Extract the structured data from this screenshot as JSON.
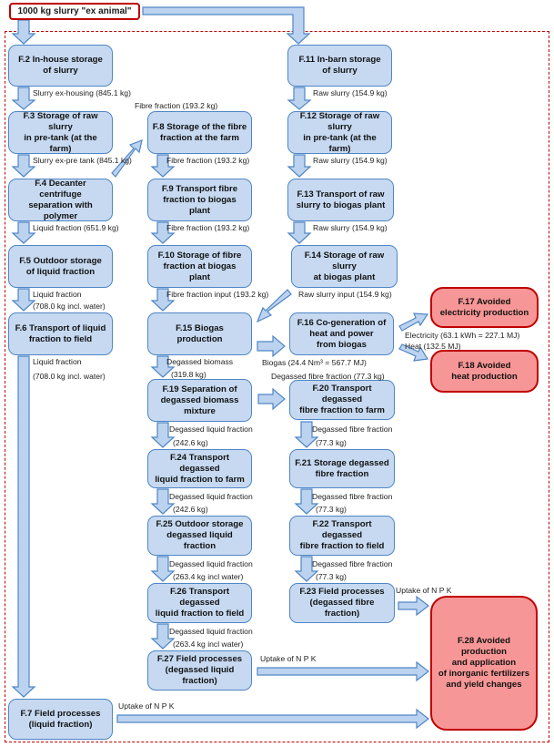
{
  "start": {
    "label": "1000 kg slurry \"ex animal\""
  },
  "nodes": {
    "f2": "F.2 In-house storage\nof slurry",
    "f3": "F.3 Storage of raw slurry\nin pre-tank (at the farm)",
    "f4": "F.4 Decanter centrifuge\nseparation with polymer",
    "f5": "F.5 Outdoor storage\nof liquid fraction",
    "f6": "F.6 Transport of liquid\nfraction to field",
    "f7": "F.7 Field processes\n(liquid fraction)",
    "f8": "F.8 Storage of the fibre\nfraction at the farm",
    "f9": "F.9 Transport fibre\nfraction to biogas plant",
    "f10": "F.10 Storage of fibre\nfraction at biogas plant",
    "f11": "F.11 In-barn storage\nof slurry",
    "f12": "F.12 Storage of raw slurry\nin pre-tank (at the farm)",
    "f13": "F.13 Transport of raw\nslurry to biogas plant",
    "f14": "F.14 Storage of raw slurry\nat biogas plant",
    "f15": "F.15 Biogas production",
    "f16": "F.16 Co-generation of\nheat and power\nfrom biogas",
    "f17": "F.17 Avoided\nelectricity production",
    "f18": "F.18 Avoided\nheat production",
    "f19": "F.19 Separation of\ndegassed biomass\nmixture",
    "f20": "F.20 Transport degassed\nfibre fraction to farm",
    "f21": "F.21 Storage degassed\nfibre fraction",
    "f22": "F.22 Transport degassed\nfibre fraction to field",
    "f23": "F.23 Field processes\n(degassed fibre fraction)",
    "f24": "F.24 Transport degassed\nliquid fraction to farm",
    "f25": "F.25 Outdoor storage\ndegassed liquid fraction",
    "f26": "F.26 Transport degassed\nliquid fraction to field",
    "f27": "F.27 Field processes\n(degassed liquid fraction)",
    "f28": "F.28 Avoided\nproduction\nand application\nof inorganic fertilizers\nand yield changes"
  },
  "flows": {
    "f2_f3": "Slurry ex-housing (845.1 kg)",
    "f3_f4": "Slurry ex-pre tank (845.1 kg)",
    "f4_f8": "Fibre fraction (193.2 kg)",
    "f4_f5": "Liquid fraction (651.9 kg)",
    "f5_f6_a": "Liquid fraction",
    "f5_f6_b": "(708.0 kg incl. water)",
    "f6_f7_a": "Liquid fraction",
    "f6_f7_b": "(708.0 kg incl. water)",
    "f7_f28": "Uptake of N  P K",
    "f8_f9": "Fibre fraction (193.2 kg)",
    "f9_f10": "Fibre fraction (193.2 kg)",
    "f10_f15": "Fibre fraction input (193.2 kg)",
    "f11_f12": "Raw slurry (154.9 kg)",
    "f12_f13": "Raw slurry (154.9 kg)",
    "f13_f14": "Raw slurry (154.9 kg)",
    "f14_f15": "Raw slurry input (154.9 kg)",
    "f15_f16": "Biogas (24.4 Nm³ = 567.7 MJ)",
    "f15_f19_a": "Degassed biomass",
    "f15_f19_b": "(319.8 kg)",
    "f16_f17": "Electricity (63.1 kWh = 227.1 MJ)",
    "f16_f18": "Heat (132.5 MJ)",
    "f19_f20": "Degassed fibre fraction (77.3 kg)",
    "f19_f24_a": "Degassed liquid fraction",
    "f19_f24_b": "(242.6 kg)",
    "f20_f21_a": "Degassed fibre fraction",
    "f20_f21_b": "(77.3 kg)",
    "f21_f22_a": "Degassed fibre fraction",
    "f21_f22_b": "(77.3 kg)",
    "f22_f23_a": "Degassed fibre fraction",
    "f22_f23_b": "(77.3 kg)",
    "f23_f28": "Uptake of N P K",
    "f24_f25_a": "Degassed liquid fraction",
    "f24_f25_b": "(242.6 kg)",
    "f25_f26_a": "Degassed liquid fraction",
    "f25_f26_b": "(263.4 kg incl water)",
    "f26_f27_a": "Degassed liquid fraction",
    "f26_f27_b": "(263.4 kg incl water)",
    "f27_f28": "Uptake of N  P K"
  },
  "colors": {
    "process_fill": "#c6d9f1",
    "process_border": "#4f86c6",
    "avoided_fill": "#f79696",
    "avoided_border": "#c00000",
    "boundary": "#c00000"
  }
}
